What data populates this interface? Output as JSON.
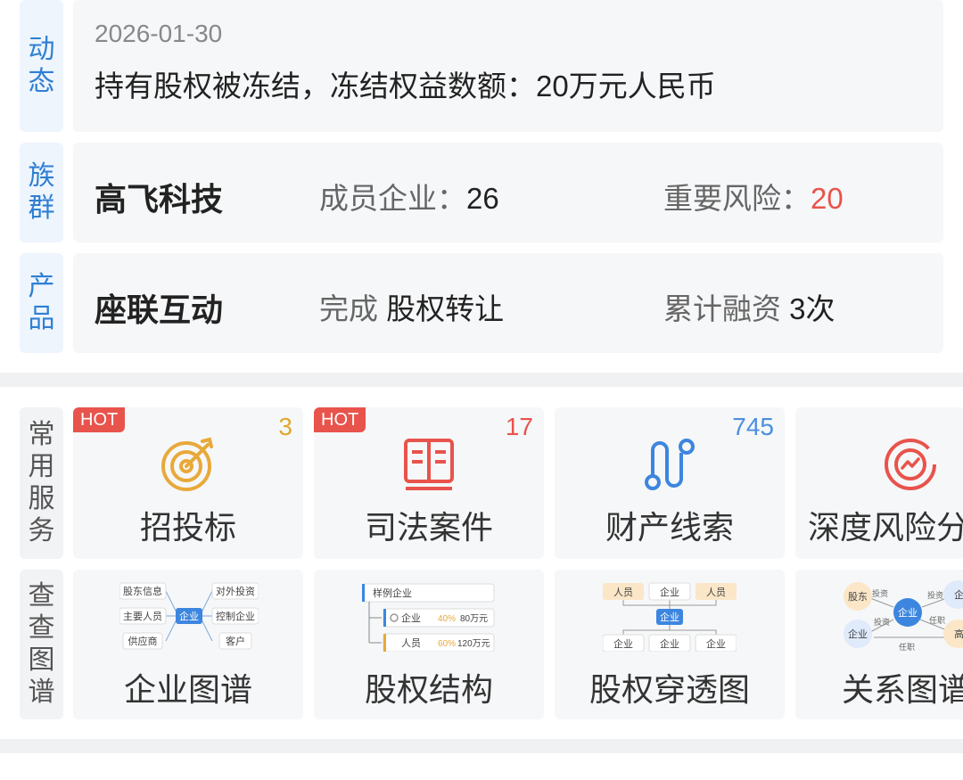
{
  "news": {
    "tab": [
      "动",
      "态"
    ],
    "date": "2026-01-30",
    "text": "持有股权被冻结，冻结权益数额：20万元人民币"
  },
  "group": {
    "tab": [
      "族",
      "群"
    ],
    "name": "高飞科技",
    "members_label": "成员企业：",
    "members_value": "26",
    "risk_label": "重要风险：",
    "risk_value": "20"
  },
  "product": {
    "tab": [
      "产",
      "品"
    ],
    "name": "座联互动",
    "status_prefix": "完成",
    "status_value": "股权转让",
    "funding_label": "累计融资",
    "funding_value": "3次"
  },
  "services": {
    "tab": [
      "常",
      "用",
      "服",
      "务"
    ],
    "items": [
      {
        "label": "招投标",
        "badge": "HOT",
        "count": "3",
        "count_color": "#e0a92a",
        "icon": "target-icon"
      },
      {
        "label": "司法案件",
        "badge": "HOT",
        "count": "17",
        "count_color": "#e8534c",
        "icon": "book-icon"
      },
      {
        "label": "财产线索",
        "badge": "",
        "count": "745",
        "count_color": "#4a8fe0",
        "icon": "path-icon"
      },
      {
        "label": "深度风险分",
        "badge": "",
        "count": "",
        "count_color": "",
        "icon": "risk-scan-icon"
      }
    ]
  },
  "graphs": {
    "tab": [
      "查",
      "查",
      "图",
      "谱"
    ],
    "items": [
      {
        "label": "企业图谱",
        "icon": "company-graph-icon",
        "mini": {
          "center": "企业",
          "tl": "股东信息",
          "ml": "主要人员",
          "bl": "供应商",
          "tr": "对外投资",
          "mr": "控制企业",
          "br": "客户"
        }
      },
      {
        "label": "股权结构",
        "icon": "equity-structure-icon",
        "mini": {
          "root": "样例企业",
          "r1": "企业",
          "r1pct": "40%",
          "r1amt": "80万元",
          "r2": "人员",
          "r2pct": "60%",
          "r2amt": "120万元"
        }
      },
      {
        "label": "股权穿透图",
        "icon": "equity-penetration-icon",
        "mini": {
          "t1": "人员",
          "t2": "企业",
          "t3": "人员",
          "center": "企业",
          "b1": "企业",
          "b2": "企业",
          "b3": "企业"
        }
      },
      {
        "label": "关系图谱",
        "icon": "relation-graph-icon",
        "mini": {
          "n1": "股东",
          "n2": "企业",
          "center": "企业",
          "n3": "企业",
          "n4": "高",
          "e1": "投资",
          "e2": "投资",
          "e3": "投资",
          "e4": "任职",
          "e5": "任职"
        }
      }
    ]
  },
  "colors": {
    "accent": "#2f7fd3",
    "hot": "#e8534c",
    "risk": "#e8534c"
  }
}
